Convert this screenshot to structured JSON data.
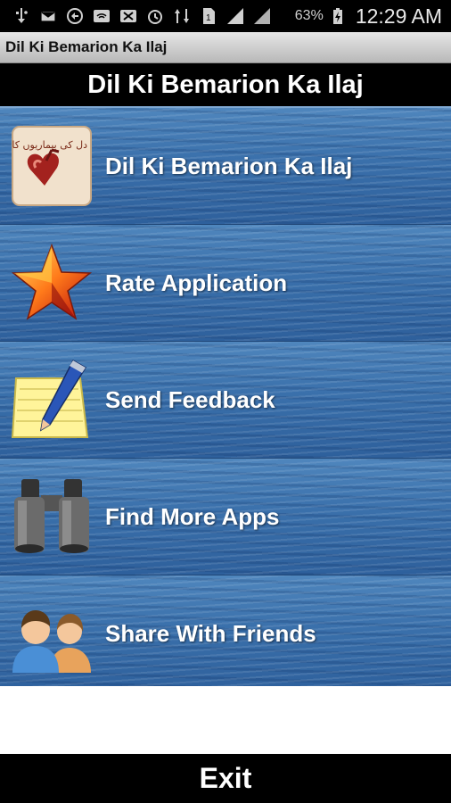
{
  "status_bar": {
    "icons": [
      "usb-icon",
      "mail-icon",
      "sync-icon",
      "wifi-icon",
      "no-signal-icon",
      "alarm-icon",
      "data-icon",
      "sim-icon",
      "signal-icon",
      "signal-icon-2"
    ],
    "battery": "63%",
    "time": "12:29 AM"
  },
  "app_title": "Dil Ki Bemarion Ka Ilaj",
  "header": {
    "title": "Dil Ki Bemarion Ka Ilaj"
  },
  "menu": {
    "items": [
      {
        "label": "Dil Ki Bemarion Ka Ilaj",
        "icon": "book-cover-icon",
        "icon_text": "دل کی بیماریوں کا علاج"
      },
      {
        "label": "Rate Application",
        "icon": "star-icon"
      },
      {
        "label": "Send Feedback",
        "icon": "notepad-pencil-icon"
      },
      {
        "label": "Find More Apps",
        "icon": "binoculars-icon"
      },
      {
        "label": "Share With Friends",
        "icon": "people-icon"
      }
    ]
  },
  "exit": {
    "label": "Exit"
  },
  "colors": {
    "menu_blue": "#3a70ab",
    "bar_black": "#000000",
    "title_gray": "#cccccc"
  }
}
